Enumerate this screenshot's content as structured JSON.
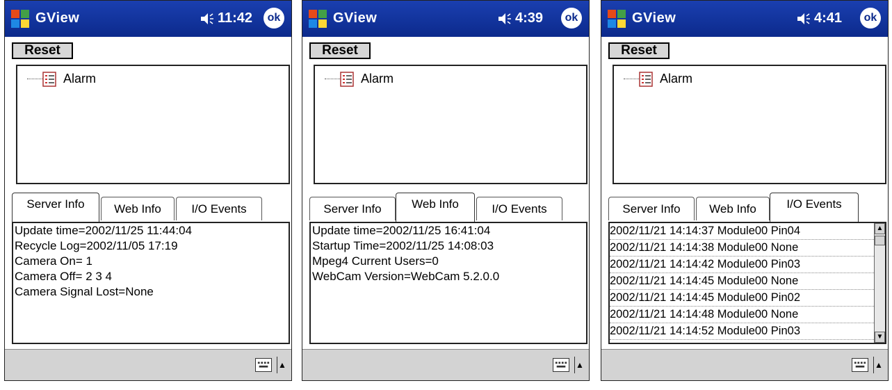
{
  "screens": [
    {
      "app_title": "GView",
      "time": "11:42",
      "ok_label": "ok",
      "reset_label": "Reset",
      "tree_item": "Alarm",
      "tabs": [
        "Server Info",
        "Web Info",
        "I/O Events"
      ],
      "active_tab": 0,
      "lines": [
        "Update time=2002/11/25 11:44:04",
        "Recycle Log=2002/11/05 17:19",
        "Camera On= 1",
        "Camera Off= 2  3  4",
        "Camera Signal Lost=None"
      ]
    },
    {
      "app_title": "GView",
      "time": "4:39",
      "ok_label": "ok",
      "reset_label": "Reset",
      "tree_item": "Alarm",
      "tabs": [
        "Server Info",
        "Web Info",
        "I/O Events"
      ],
      "active_tab": 1,
      "lines": [
        "Update time=2002/11/25 16:41:04",
        "Startup Time=2002/11/25 14:08:03",
        "Mpeg4 Current Users=0",
        "WebCam Version=WebCam 5.2.0.0"
      ]
    },
    {
      "app_title": "GView",
      "time": "4:41",
      "ok_label": "ok",
      "reset_label": "Reset",
      "tree_item": "Alarm",
      "tabs": [
        "Server Info",
        "Web Info",
        "I/O Events"
      ],
      "active_tab": 2,
      "events": [
        "2002/11/21 14:14:37 Module00 Pin04",
        "2002/11/21 14:14:38 Module00 None",
        "2002/11/21 14:14:42 Module00 Pin03",
        "2002/11/21 14:14:45 Module00 None",
        "2002/11/21 14:14:45 Module00 Pin02",
        "2002/11/21 14:14:48 Module00 None",
        "2002/11/21 14:14:52 Module00 Pin03"
      ]
    }
  ],
  "colors": {
    "titlebar": "#0c2a8c",
    "bottombar": "#d3d3d3"
  },
  "icons": [
    "windows-start-icon",
    "speaker-icon",
    "ok-icon",
    "alarm-list-icon",
    "keyboard-icon",
    "up-arrow-icon"
  ]
}
